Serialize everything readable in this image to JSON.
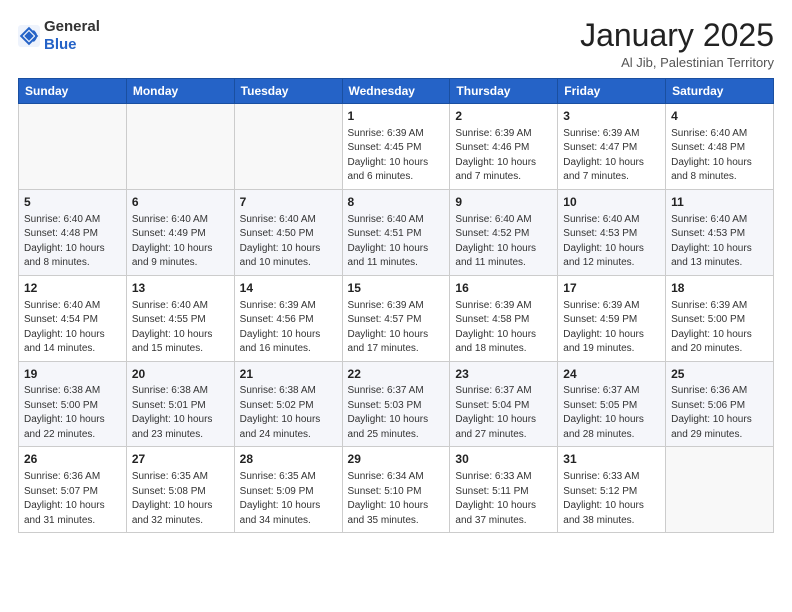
{
  "header": {
    "logo_general": "General",
    "logo_blue": "Blue",
    "main_title": "January 2025",
    "subtitle": "Al Jib, Palestinian Territory"
  },
  "weekdays": [
    "Sunday",
    "Monday",
    "Tuesday",
    "Wednesday",
    "Thursday",
    "Friday",
    "Saturday"
  ],
  "weeks": [
    [
      {
        "num": "",
        "info": ""
      },
      {
        "num": "",
        "info": ""
      },
      {
        "num": "",
        "info": ""
      },
      {
        "num": "1",
        "info": "Sunrise: 6:39 AM\nSunset: 4:45 PM\nDaylight: 10 hours\nand 6 minutes."
      },
      {
        "num": "2",
        "info": "Sunrise: 6:39 AM\nSunset: 4:46 PM\nDaylight: 10 hours\nand 7 minutes."
      },
      {
        "num": "3",
        "info": "Sunrise: 6:39 AM\nSunset: 4:47 PM\nDaylight: 10 hours\nand 7 minutes."
      },
      {
        "num": "4",
        "info": "Sunrise: 6:40 AM\nSunset: 4:48 PM\nDaylight: 10 hours\nand 8 minutes."
      }
    ],
    [
      {
        "num": "5",
        "info": "Sunrise: 6:40 AM\nSunset: 4:48 PM\nDaylight: 10 hours\nand 8 minutes."
      },
      {
        "num": "6",
        "info": "Sunrise: 6:40 AM\nSunset: 4:49 PM\nDaylight: 10 hours\nand 9 minutes."
      },
      {
        "num": "7",
        "info": "Sunrise: 6:40 AM\nSunset: 4:50 PM\nDaylight: 10 hours\nand 10 minutes."
      },
      {
        "num": "8",
        "info": "Sunrise: 6:40 AM\nSunset: 4:51 PM\nDaylight: 10 hours\nand 11 minutes."
      },
      {
        "num": "9",
        "info": "Sunrise: 6:40 AM\nSunset: 4:52 PM\nDaylight: 10 hours\nand 11 minutes."
      },
      {
        "num": "10",
        "info": "Sunrise: 6:40 AM\nSunset: 4:53 PM\nDaylight: 10 hours\nand 12 minutes."
      },
      {
        "num": "11",
        "info": "Sunrise: 6:40 AM\nSunset: 4:53 PM\nDaylight: 10 hours\nand 13 minutes."
      }
    ],
    [
      {
        "num": "12",
        "info": "Sunrise: 6:40 AM\nSunset: 4:54 PM\nDaylight: 10 hours\nand 14 minutes."
      },
      {
        "num": "13",
        "info": "Sunrise: 6:40 AM\nSunset: 4:55 PM\nDaylight: 10 hours\nand 15 minutes."
      },
      {
        "num": "14",
        "info": "Sunrise: 6:39 AM\nSunset: 4:56 PM\nDaylight: 10 hours\nand 16 minutes."
      },
      {
        "num": "15",
        "info": "Sunrise: 6:39 AM\nSunset: 4:57 PM\nDaylight: 10 hours\nand 17 minutes."
      },
      {
        "num": "16",
        "info": "Sunrise: 6:39 AM\nSunset: 4:58 PM\nDaylight: 10 hours\nand 18 minutes."
      },
      {
        "num": "17",
        "info": "Sunrise: 6:39 AM\nSunset: 4:59 PM\nDaylight: 10 hours\nand 19 minutes."
      },
      {
        "num": "18",
        "info": "Sunrise: 6:39 AM\nSunset: 5:00 PM\nDaylight: 10 hours\nand 20 minutes."
      }
    ],
    [
      {
        "num": "19",
        "info": "Sunrise: 6:38 AM\nSunset: 5:00 PM\nDaylight: 10 hours\nand 22 minutes."
      },
      {
        "num": "20",
        "info": "Sunrise: 6:38 AM\nSunset: 5:01 PM\nDaylight: 10 hours\nand 23 minutes."
      },
      {
        "num": "21",
        "info": "Sunrise: 6:38 AM\nSunset: 5:02 PM\nDaylight: 10 hours\nand 24 minutes."
      },
      {
        "num": "22",
        "info": "Sunrise: 6:37 AM\nSunset: 5:03 PM\nDaylight: 10 hours\nand 25 minutes."
      },
      {
        "num": "23",
        "info": "Sunrise: 6:37 AM\nSunset: 5:04 PM\nDaylight: 10 hours\nand 27 minutes."
      },
      {
        "num": "24",
        "info": "Sunrise: 6:37 AM\nSunset: 5:05 PM\nDaylight: 10 hours\nand 28 minutes."
      },
      {
        "num": "25",
        "info": "Sunrise: 6:36 AM\nSunset: 5:06 PM\nDaylight: 10 hours\nand 29 minutes."
      }
    ],
    [
      {
        "num": "26",
        "info": "Sunrise: 6:36 AM\nSunset: 5:07 PM\nDaylight: 10 hours\nand 31 minutes."
      },
      {
        "num": "27",
        "info": "Sunrise: 6:35 AM\nSunset: 5:08 PM\nDaylight: 10 hours\nand 32 minutes."
      },
      {
        "num": "28",
        "info": "Sunrise: 6:35 AM\nSunset: 5:09 PM\nDaylight: 10 hours\nand 34 minutes."
      },
      {
        "num": "29",
        "info": "Sunrise: 6:34 AM\nSunset: 5:10 PM\nDaylight: 10 hours\nand 35 minutes."
      },
      {
        "num": "30",
        "info": "Sunrise: 6:33 AM\nSunset: 5:11 PM\nDaylight: 10 hours\nand 37 minutes."
      },
      {
        "num": "31",
        "info": "Sunrise: 6:33 AM\nSunset: 5:12 PM\nDaylight: 10 hours\nand 38 minutes."
      },
      {
        "num": "",
        "info": ""
      }
    ]
  ]
}
